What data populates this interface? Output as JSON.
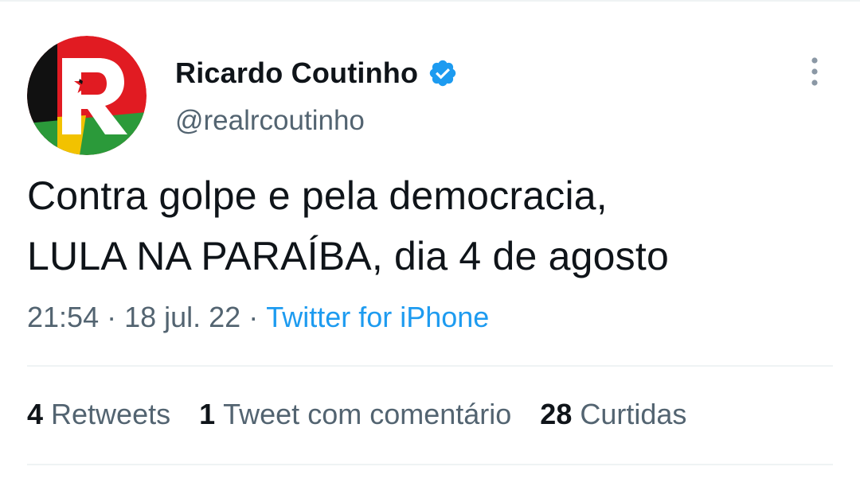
{
  "tweet": {
    "author": {
      "display_name": "Ricardo Coutinho",
      "handle": "@realrcoutinho",
      "verified": true,
      "avatar_icon": "party-logo-r-with-star",
      "verified_icon": "verified-badge-icon",
      "verified_color": "#1d9bf0"
    },
    "text_line1": "Contra golpe e pela democracia,",
    "text_line2": "LULA NA PARAÍBA, dia 4 de agosto",
    "meta": {
      "time": "21:54",
      "date": "18 jul. 22",
      "separator": "·",
      "source": "Twitter for iPhone"
    },
    "stats": {
      "retweets_count": "4",
      "retweets_label": "Retweets",
      "quotes_count": "1",
      "quotes_label": "Tweet com comentário",
      "likes_count": "28",
      "likes_label": "Curtidas"
    },
    "more_icon": "more-vertical-icon"
  },
  "colors": {
    "text_primary": "#0f1419",
    "text_secondary": "#536471",
    "link": "#1d9bf0",
    "divider": "#eff3f4"
  }
}
